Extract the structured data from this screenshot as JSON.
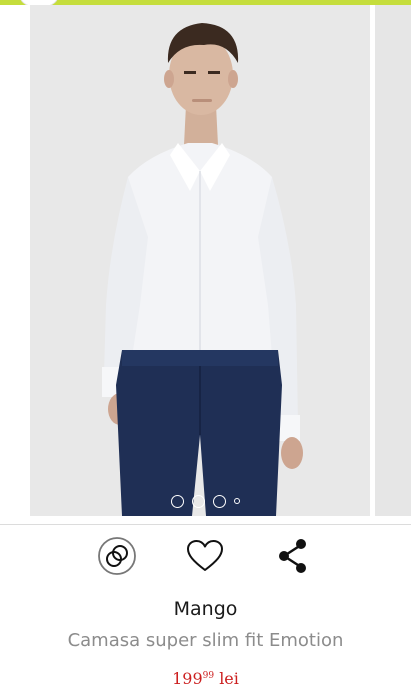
{
  "product": {
    "brand": "Mango",
    "title": "Camasa super slim fit Emotion",
    "price": {
      "integer": "199",
      "decimals": "99",
      "currency": "lei"
    },
    "gallery": {
      "image_count": 4,
      "active_index": 0
    }
  },
  "colors": {
    "accent_stripe": "#c5dd3c",
    "price": "#cc1f1f",
    "shirt": "#f3f4f7",
    "trousers": "#1f2f55",
    "photo_background": "#e8e8e8"
  },
  "actions": {
    "compare_icon": "compare-rings-icon",
    "favorite_icon": "heart-icon",
    "share_icon": "share-icon"
  }
}
